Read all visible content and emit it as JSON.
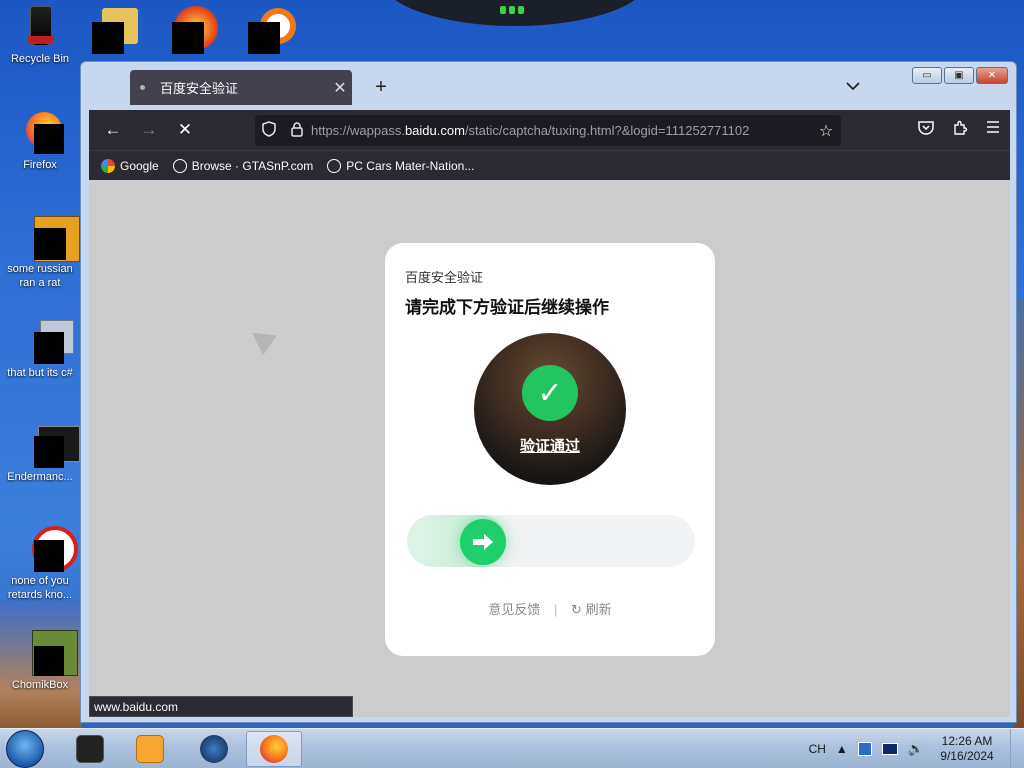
{
  "desktop": {
    "icons": [
      {
        "label": "Recycle Bin"
      },
      {
        "label": "Firefox"
      },
      {
        "label": "some russian ran a rat"
      },
      {
        "label": "that but its c#"
      },
      {
        "label": "Endermanc..."
      },
      {
        "label": "none of you retards kno..."
      },
      {
        "label": "ChomikBox"
      }
    ]
  },
  "browser": {
    "tab": {
      "title": "百度安全验证",
      "close_glyph": "✕"
    },
    "new_tab_glyph": "+",
    "tab_list_glyph": "⌄",
    "window_controls": {
      "minimize": "▭",
      "maximize": "▣",
      "close": "✕"
    },
    "nav": {
      "back": "←",
      "forward": "→",
      "stop": "✕"
    },
    "url": {
      "prefix": "https://wappass.",
      "domain": "baidu.com",
      "suffix": "/static/captcha/tuxing.html?&logid=111252771102",
      "shield_icon": "shield-icon",
      "lock_icon": "lock-icon"
    },
    "bookmarks": [
      {
        "label": "Google",
        "icon": "google-icon"
      },
      {
        "label": "Browse · GTASnP.com",
        "icon": "globe-icon"
      },
      {
        "label": "PC Cars Mater-Nation...",
        "icon": "globe-icon"
      }
    ],
    "status_url": "www.baidu.com"
  },
  "captcha": {
    "subtitle": "百度安全验证",
    "title": "请完成下方验证后继续操作",
    "result_text": "验证通过",
    "slider_progress": 0.22,
    "feedback_label": "意见反馈",
    "separator": "|",
    "refresh_label": "刷新",
    "accent_color": "#1fcf6c"
  },
  "taskbar": {
    "language": "CH",
    "time": "12:26 AM",
    "date": "9/16/2024"
  }
}
